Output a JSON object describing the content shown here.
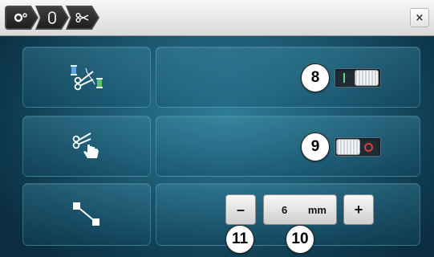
{
  "breadcrumb": [
    {
      "icon": "sewing-settings-icon"
    },
    {
      "icon": "bobbin-icon"
    },
    {
      "icon": "scissors-icon"
    }
  ],
  "window": {
    "close_label": "×"
  },
  "rows": [
    {
      "icon": "auto-thread-cut-icon",
      "toggle_state": "on",
      "callout": "8"
    },
    {
      "icon": "manual-cut-hand-icon",
      "toggle_state": "off",
      "callout": "9"
    },
    {
      "icon": "jump-stitch-length-icon"
    }
  ],
  "stepper": {
    "minus_label": "–",
    "plus_label": "+",
    "value": "6",
    "unit": "mm",
    "callout_minus": "11",
    "callout_value": "10"
  },
  "colors": {
    "toggle_on": "#6fd08a",
    "toggle_off": "#e23b3b"
  }
}
